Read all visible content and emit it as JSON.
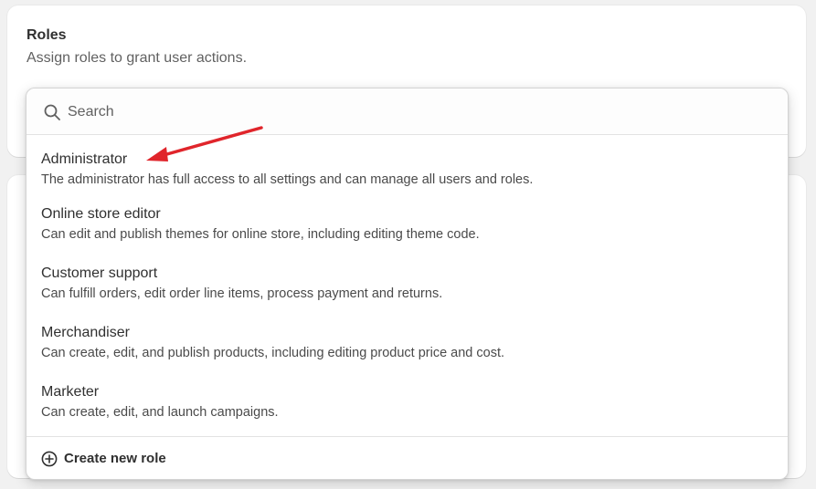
{
  "roles_card": {
    "title": "Roles",
    "subtitle": "Assign roles to grant user actions."
  },
  "search": {
    "placeholder": "Search",
    "icon": "search-icon"
  },
  "roles": [
    {
      "name": "Administrator",
      "description": "The administrator has full access to all settings and can manage all users and roles."
    },
    {
      "name": "Online store editor",
      "description": "Can edit and publish themes for online store, including editing theme code."
    },
    {
      "name": "Customer support",
      "description": "Can fulfill orders, edit order line items, process payment and returns."
    },
    {
      "name": "Merchandiser",
      "description": "Can create, edit, and publish products, including editing product price and cost."
    },
    {
      "name": "Marketer",
      "description": "Can create, edit, and launch campaigns."
    }
  ],
  "footer": {
    "create_label": "Create new role",
    "icon": "plus-circle-icon"
  },
  "annotation": {
    "arrow_color": "#e0252b"
  }
}
